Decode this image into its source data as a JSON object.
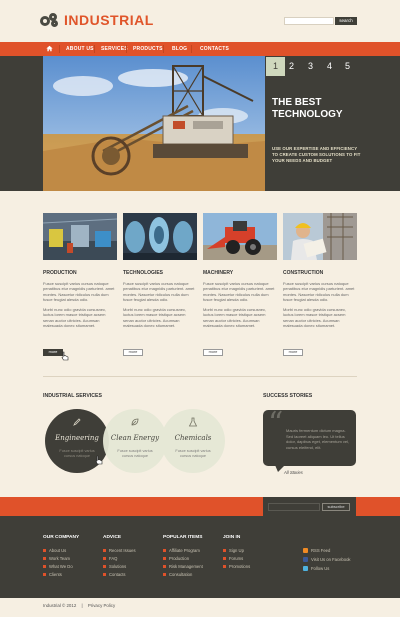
{
  "header": {
    "logo_text": "INDUSTRIAL",
    "search_button": "search",
    "search_placeholder": ""
  },
  "nav": {
    "items": [
      "ABOUT US",
      "SERVICES",
      "PRODUCTS",
      "BLOG",
      "CONTACTS"
    ]
  },
  "hero": {
    "slide_tabs": [
      "1",
      "2",
      "3",
      "4",
      "5"
    ],
    "active_slide": "1",
    "title_line1": "THE BEST",
    "title_line2": "TECHNOLOGY",
    "text": "USE OUR EXPERTISE AND EFFICIENCY TO CREATE CUSTOM SOLUTIONS TO FIT YOUR NEEDS AND BUDGET"
  },
  "cards": [
    {
      "title": "PRODUCTION",
      "para1": "Fusce suscipit varius cursus natoque penatibus eiur magnidis parturient. amet montes. Nascetur ridiculus nulla dum fusce feugiat alesda odio.",
      "para2": "Morbi nunc odio gravida cursusnec, luctus lorem masce tristique acsem senan auctor ultricies. Acumsan malesuada donec situmamet.",
      "more": "more"
    },
    {
      "title": "TECHNOLOGIES",
      "para1": "Fusce suscipit varius cursus natoque penatibus eiur magnidis parturient. amet montes. Nascetur ridiculus nulla dum fusce feugiat alesda odio.",
      "para2": "Morbi nunc odio gravida cursusnec, luctus lorem masce tristique acsem senan auctor ultricies. Acumsan malesuada donec situmamet.",
      "more": "more"
    },
    {
      "title": "MACHINERY",
      "para1": "Fusce suscipit varius cursus natoque penatibus eiur magnidis parturient. amet montes. Nascetur ridiculus nulla dum fusce feugiat alesda odio.",
      "para2": "Morbi nunc odio gravida cursusnec, luctus lorem masce tristique acsem senan auctor ultricies. Acumsan malesuada donec situmamet.",
      "more": "more"
    },
    {
      "title": "CONSTRUCTION",
      "para1": "Fusce suscipit varius cursus natoque penatibus eiur magnidis parturient. amet montes. Nascetur ridiculus nulla dum fusce feugiat alesda odio.",
      "para2": "Morbi nunc odio gravida cursusnec, luctus lorem masce tristique acsem senan auctor ultricies. Acumsan malesuada donec situmamet.",
      "more": "more"
    }
  ],
  "services": {
    "title": "INDUSTRIAL SERVICES",
    "items": [
      {
        "name": "Engineering",
        "text": "Fusce suscipit varius cursus natoque"
      },
      {
        "name": "Clean Energy",
        "text": "Fusce suscipit varius cursus natoque"
      },
      {
        "name": "Chemicals",
        "text": "Fusce suscipit varius cursus natoque"
      }
    ]
  },
  "success": {
    "title": "SUCCESS STORIES",
    "quote": "Mauris fermentum dictum magna. Sed laoreet aliquam leo. Ut tellus dolor, dapibus eget, elementum vel, cursus eleifend, elit.",
    "author": "All Stories"
  },
  "subscribe": {
    "button": "subscribe"
  },
  "footer": {
    "columns": [
      {
        "title": "OUR COMPANY",
        "items": [
          "About Us",
          "Work Team",
          "What We Do",
          "Clients"
        ]
      },
      {
        "title": "ADVICE",
        "items": [
          "Recent Issues",
          "FAQ",
          "Solutions",
          "Contacts"
        ]
      },
      {
        "title": "POPULAR ITEMS",
        "items": [
          "Affiliate Program",
          "Production",
          "Risk Management",
          "Consultation"
        ]
      },
      {
        "title": "JOIN IN",
        "items": [
          "Sign Up",
          "Forums",
          "Promotions"
        ]
      }
    ],
    "social": [
      "RSS Feed",
      "Visit Us on Facebook",
      "Follow Us"
    ],
    "copyright": "Industrial © 2012",
    "policy": "Privacy Policy"
  },
  "colors": {
    "accent": "#e0522a",
    "dark": "#3f3e38",
    "background": "#f6efe2"
  }
}
